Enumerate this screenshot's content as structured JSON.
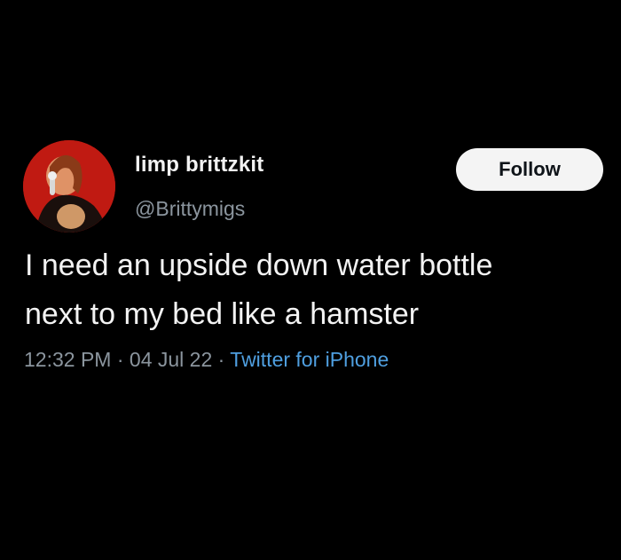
{
  "user": {
    "display_name": "limp brittzkit",
    "handle": "@Brittymigs",
    "avatar_icon": "profile-photo-avatar"
  },
  "follow_button": {
    "label": "Follow"
  },
  "tweet": {
    "text_lines": [
      "I need an upside down water bottle",
      "next to my bed like a hamster"
    ],
    "time": "12:32 PM",
    "separator": " · ",
    "date": "04 Jul 22",
    "source": "Twitter for iPhone"
  },
  "colors": {
    "background": "#000000",
    "text": "#f3f3f3",
    "secondary_text": "#8b959e",
    "link": "#4f9fe0",
    "follow_button_bg": "#f4f4f4",
    "avatar_red": "#c21a12"
  }
}
